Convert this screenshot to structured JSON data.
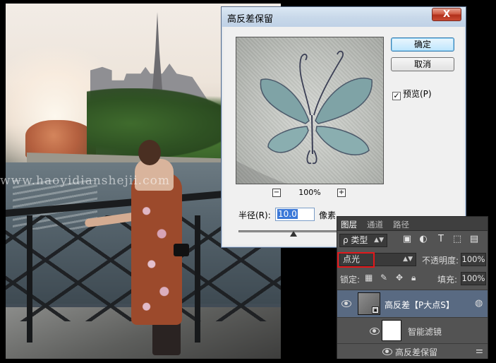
{
  "watermark": "www.haoyidianshejii.com",
  "dialog": {
    "title": "高反差保留",
    "close_label": "X",
    "ok_label": "确定",
    "cancel_label": "取消",
    "preview_label": "预览(P)",
    "preview_checked": true,
    "zoom_level": "100%",
    "zoom_out": "−",
    "zoom_in": "+",
    "radius_label": "半径(R):",
    "radius_value": "10.0",
    "radius_unit": "像素"
  },
  "layers_panel": {
    "tabs": [
      {
        "label": "图层",
        "active": true
      },
      {
        "label": "通道",
        "active": false
      },
      {
        "label": "路径",
        "active": false
      }
    ],
    "filter_kind": "ρ 类型",
    "blend_mode": "点光",
    "opacity_label": "不透明度:",
    "opacity_value": "100%",
    "lock_label": "锁定:",
    "fill_label": "填充:",
    "fill_value": "100%",
    "layers": [
      {
        "name": "高反差【P大点S】",
        "selected": true
      },
      {
        "name": "智能滤镜",
        "selected": false
      },
      {
        "name": "高反差保留",
        "selected": false
      }
    ]
  },
  "colors": {
    "layer_selected": "#596a82",
    "blend_highlight": "#e2181b",
    "panel_bg": "#535353"
  },
  "icons": [
    "close-icon",
    "zoom-out-icon",
    "zoom-in-icon",
    "checkbox-icon",
    "pixel-filter-icon",
    "adjustment-filter-icon",
    "type-filter-icon",
    "shape-filter-icon",
    "smart-object-filter-icon",
    "lock-pixels-icon",
    "lock-brush-icon",
    "lock-position-icon",
    "lock-all-icon",
    "eye-icon",
    "filter-options-icon"
  ]
}
